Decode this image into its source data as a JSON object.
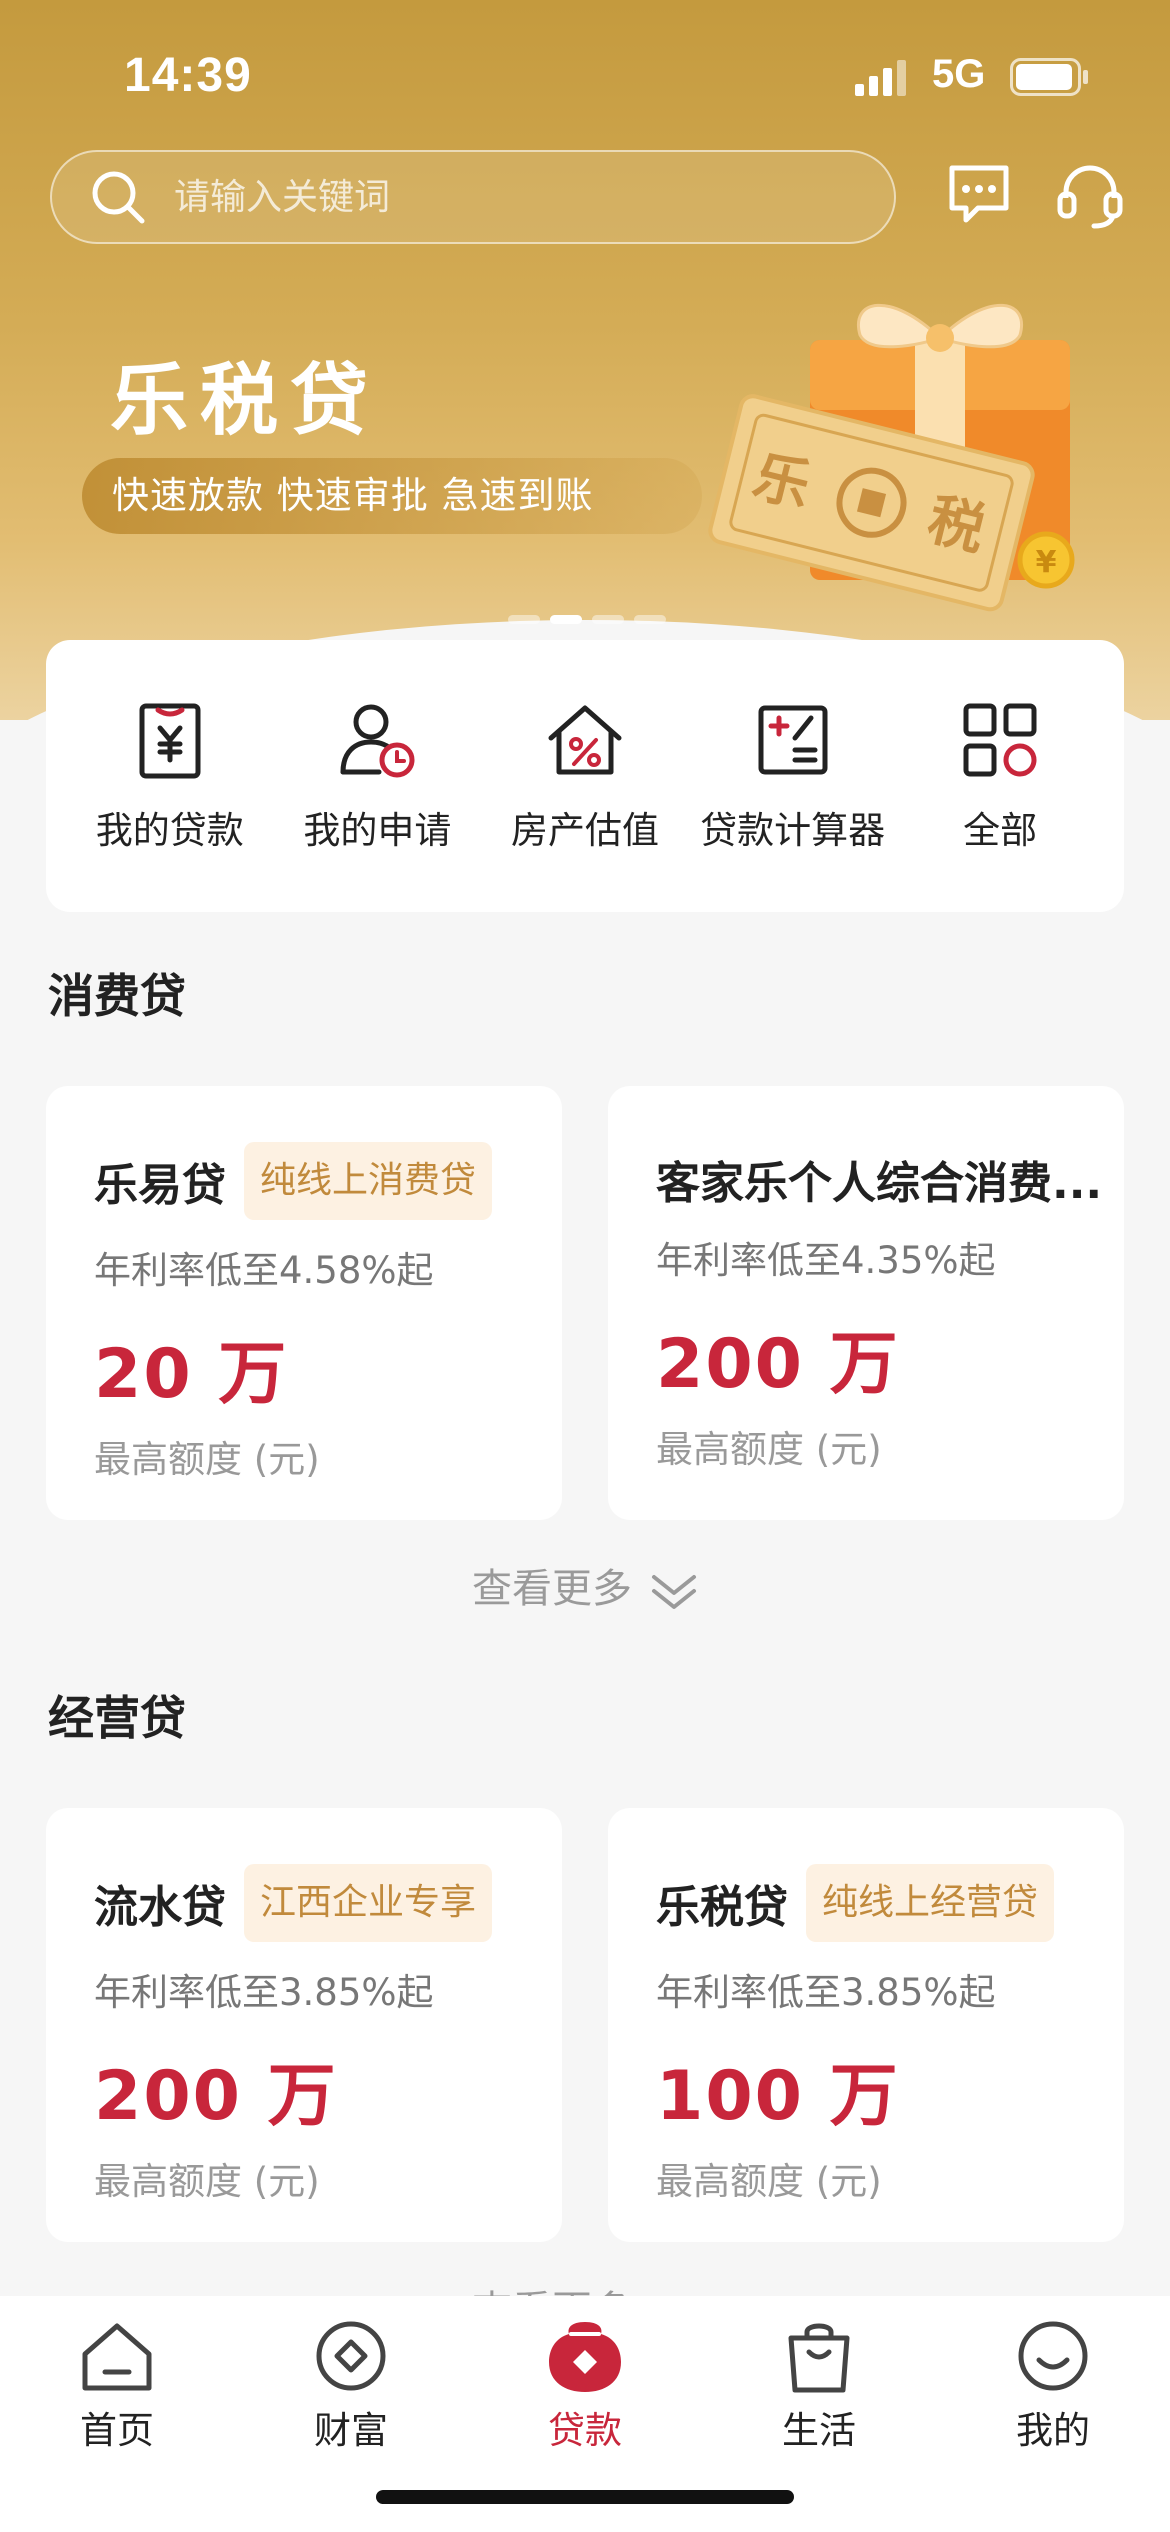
{
  "status_bar": {
    "time": "14:39",
    "network": "5G"
  },
  "search": {
    "placeholder": "请输入关键词"
  },
  "banner": {
    "title": "乐税贷",
    "subtitle": "快速放款 快速审批 急速到账",
    "art_text_left": "乐",
    "art_text_right": "税",
    "coin_symbol": "¥",
    "slide_count": 4,
    "active_slide": 1
  },
  "quick_actions": [
    {
      "label": "我的贷款",
      "icon": "loan-yuan-icon"
    },
    {
      "label": "我的申请",
      "icon": "user-clock-icon"
    },
    {
      "label": "房产估值",
      "icon": "house-percent-icon"
    },
    {
      "label": "贷款计算器",
      "icon": "calculator-icon"
    },
    {
      "label": "全部",
      "icon": "grid-all-icon"
    }
  ],
  "consumer_section": {
    "title": "消费贷",
    "cards": [
      {
        "name": "乐易贷",
        "tag": "纯线上消费贷",
        "rate": "年利率低至4.58%起",
        "amount": "20 万",
        "caption": "最高额度 (元)"
      },
      {
        "name": "客家乐个人综合消费...",
        "tag": "",
        "rate": "年利率低至4.35%起",
        "amount": "200 万",
        "caption": "最高额度 (元)"
      }
    ],
    "see_more": "查看更多"
  },
  "business_section": {
    "title": "经营贷",
    "cards": [
      {
        "name": "流水贷",
        "tag": "江西企业专享",
        "rate": "年利率低至3.85%起",
        "amount": "200 万",
        "caption": "最高额度 (元)"
      },
      {
        "name": "乐税贷",
        "tag": "纯线上经营贷",
        "rate": "年利率低至3.85%起",
        "amount": "100 万",
        "caption": "最高额度 (元)"
      }
    ],
    "see_more": "查看更多"
  },
  "tab_bar": {
    "tabs": [
      {
        "label": "首页",
        "icon": "home-icon"
      },
      {
        "label": "财富",
        "icon": "wealth-icon"
      },
      {
        "label": "贷款",
        "icon": "loan-icon",
        "active": true
      },
      {
        "label": "生活",
        "icon": "shopping-bag-icon"
      },
      {
        "label": "我的",
        "icon": "smile-icon"
      }
    ]
  },
  "colors": {
    "brand_gold": "#c49a3e",
    "accent_red": "#c8263b",
    "tag_bg": "#fdf1e2",
    "tag_text": "#c18a3c"
  }
}
